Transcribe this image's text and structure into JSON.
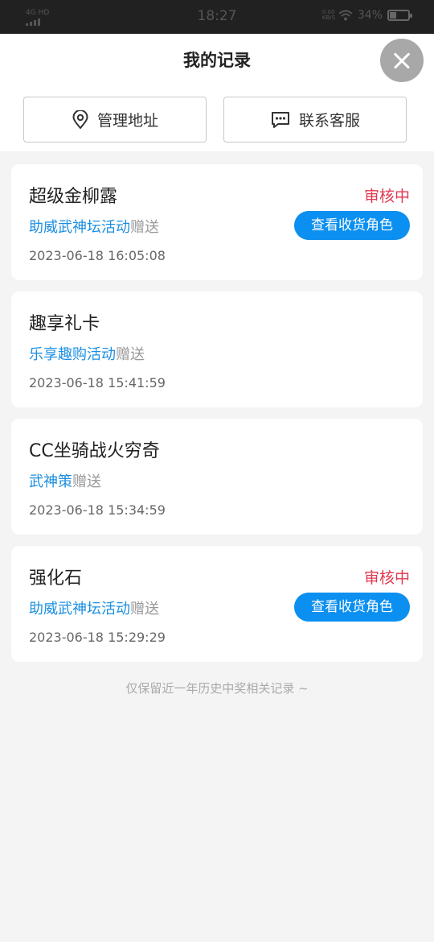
{
  "status_bar": {
    "time": "18:27",
    "signal_label": "4G HD",
    "network_label": "0.00 KB/S",
    "battery": "34%"
  },
  "header": {
    "title": "我的记录",
    "manage_address_label": "管理地址",
    "contact_service_label": "联系客服"
  },
  "records": [
    {
      "name": "超级金柳露",
      "status": "审核中",
      "activity": "助威武神坛活动",
      "suffix": "赠送",
      "time": "2023-06-18 16:05:08",
      "action_label": "查看收货角色"
    },
    {
      "name": "趣享礼卡",
      "status": "",
      "activity": "乐享趣购活动",
      "suffix": "赠送",
      "time": "2023-06-18 15:41:59",
      "action_label": ""
    },
    {
      "name": "CC坐骑战火穷奇",
      "status": "",
      "activity": "武神策",
      "suffix": "赠送",
      "time": "2023-06-18 15:34:59",
      "action_label": ""
    },
    {
      "name": "强化石",
      "status": "审核中",
      "activity": "助威武神坛活动",
      "suffix": "赠送",
      "time": "2023-06-18 15:29:29",
      "action_label": "查看收货角色"
    }
  ],
  "footer_note": "仅保留近一年历史中奖相关记录 ~",
  "colors": {
    "accent": "#0b8ff0",
    "status": "#e0394f",
    "link": "#1c8fe0"
  }
}
